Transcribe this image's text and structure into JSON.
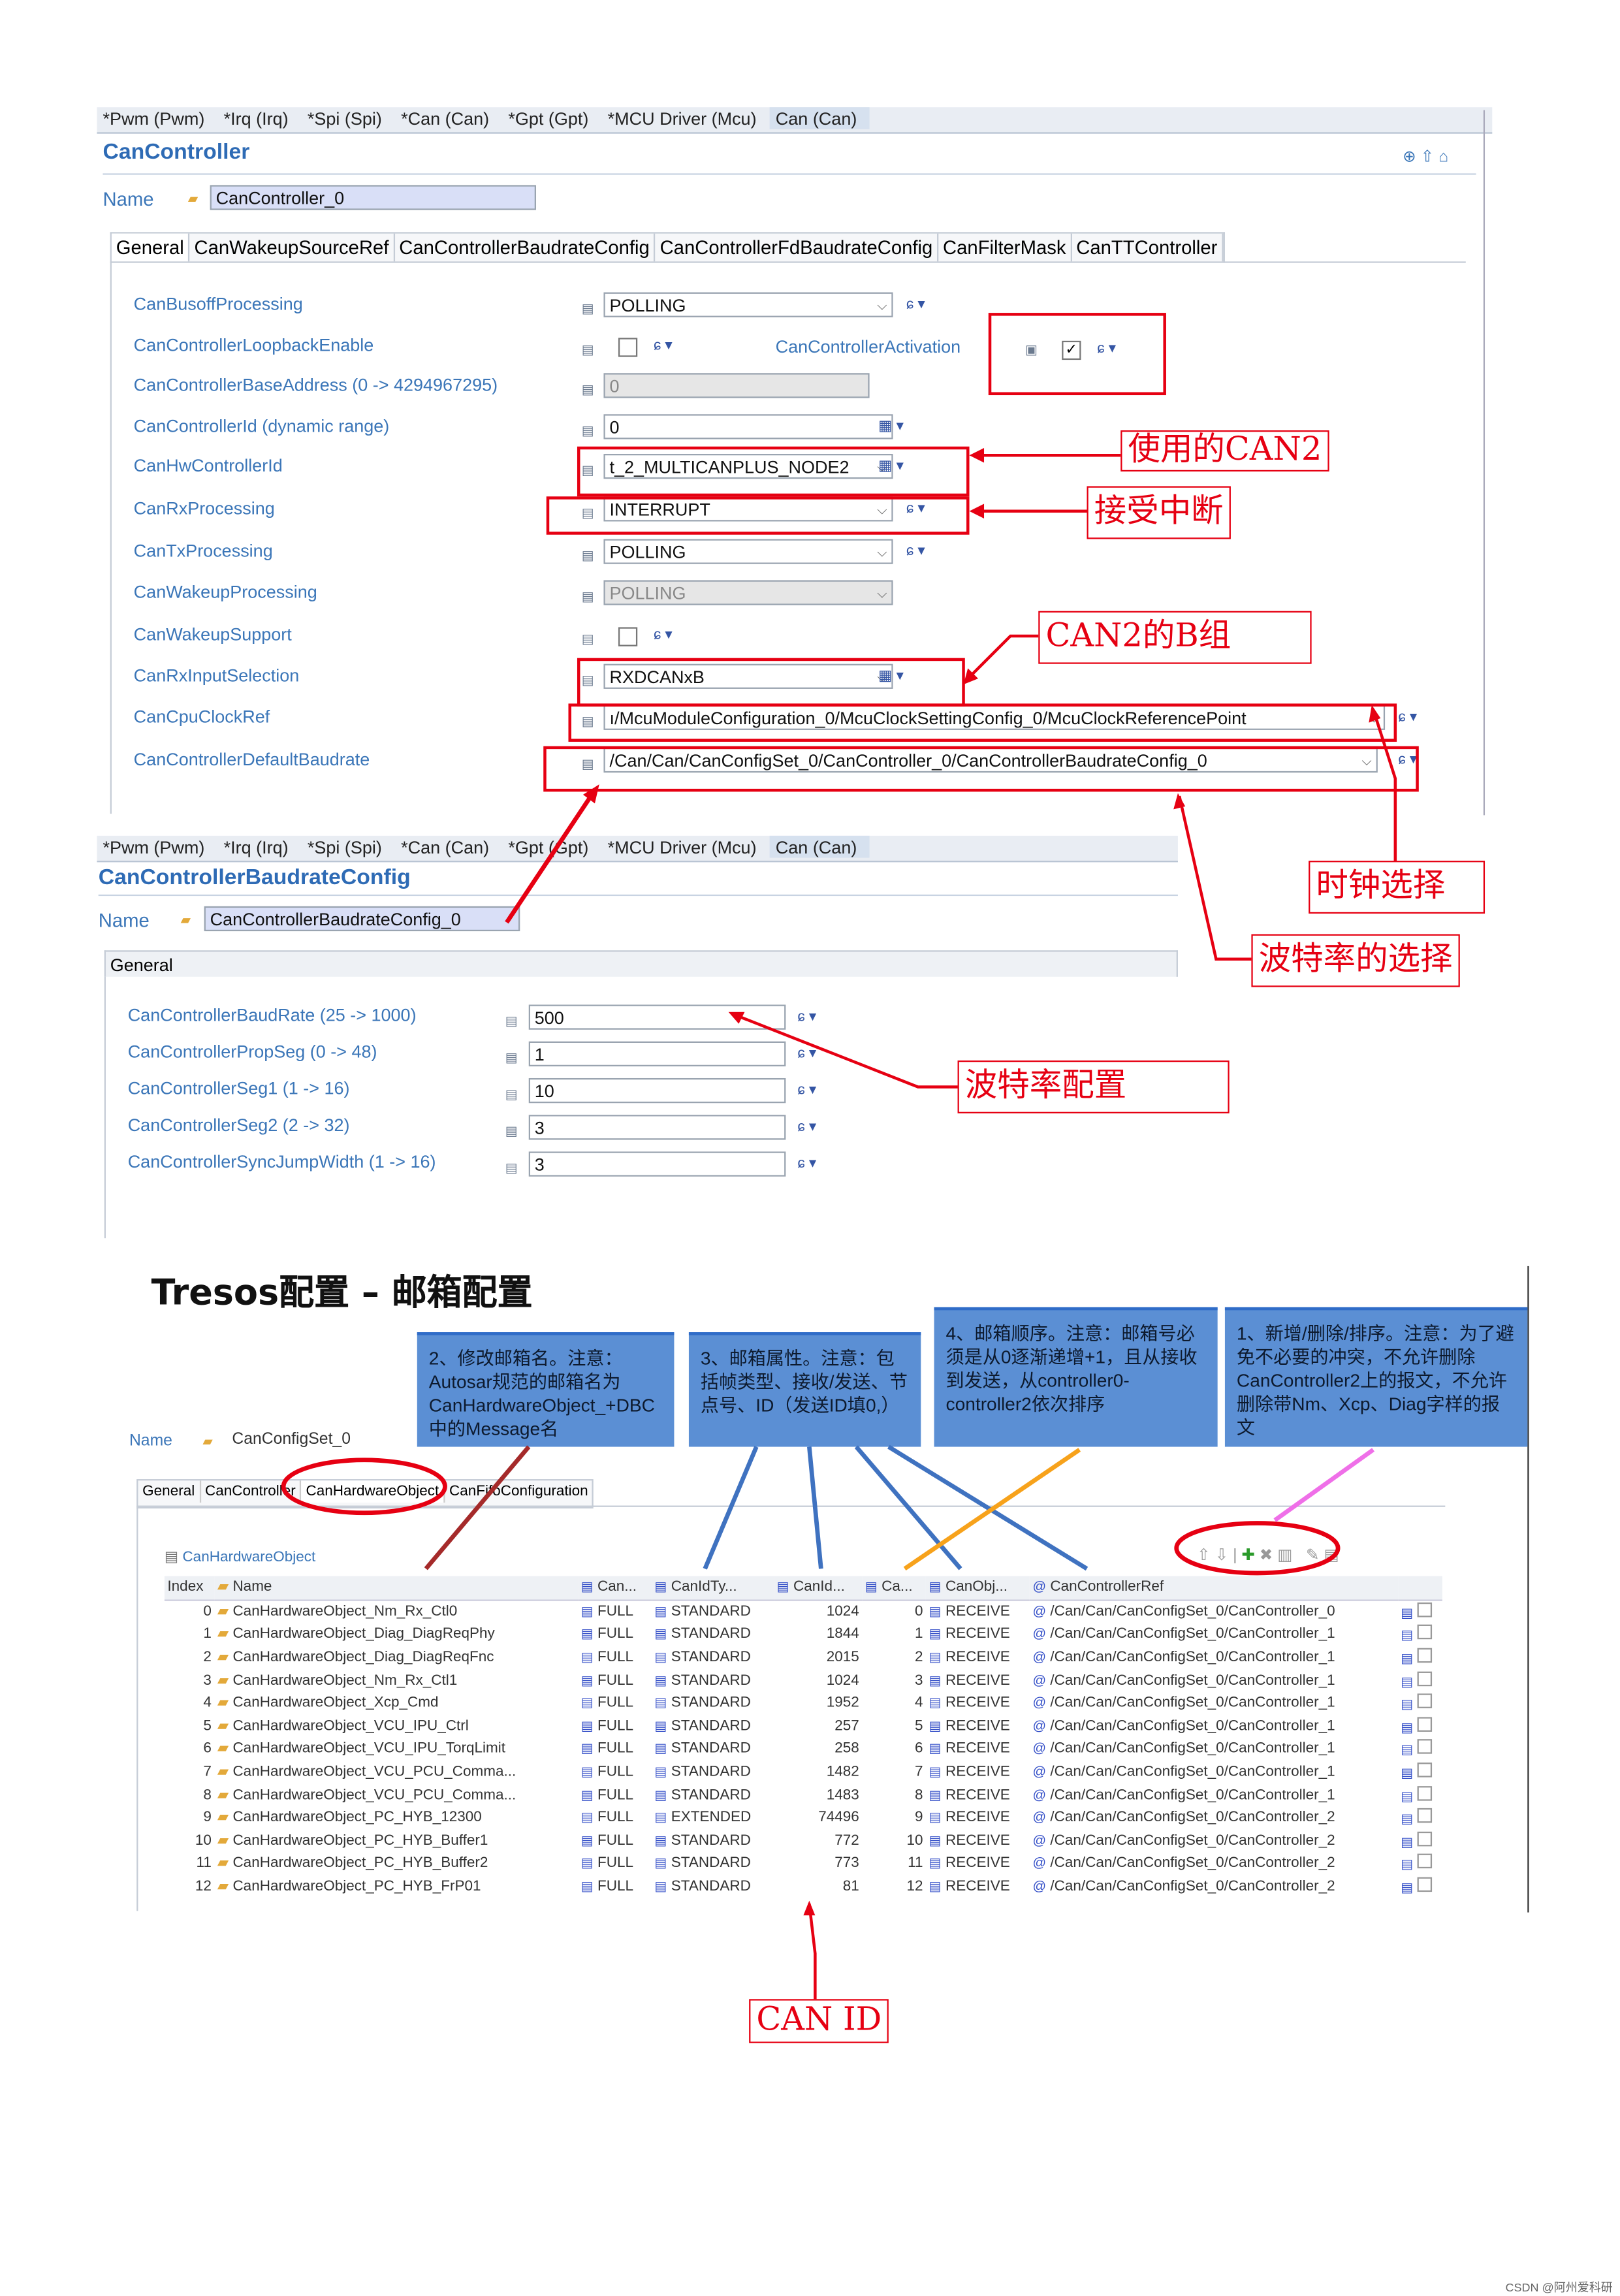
{
  "panel1": {
    "tabs": [
      "*Pwm (Pwm)",
      "*Irq (Irq)",
      "*Spi (Spi)",
      "*Can (Can)",
      "*Gpt (Gpt)",
      "*MCU Driver (Mcu)",
      "Can (Can)"
    ],
    "title": "CanController",
    "name_label": "Name",
    "name_value": "CanController_0",
    "subtabs": [
      "General",
      "CanWakeupSourceRef",
      "CanControllerBaudrateConfig",
      "CanControllerFdBaudrateConfig",
      "CanFilterMask",
      "CanTTController"
    ],
    "fields": [
      {
        "label": "CanBusoffProcessing",
        "value": "POLLING",
        "type": "select"
      },
      {
        "label": "CanControllerLoopbackEnable",
        "value": "",
        "type": "checkbox",
        "checked": false
      },
      {
        "label": "CanControllerBaseAddress (0 -> 4294967295)",
        "value": "0",
        "type": "disabled"
      },
      {
        "label": "CanControllerId (dynamic range)",
        "value": "0",
        "type": "text"
      },
      {
        "label": "CanHwControllerId",
        "value": "t_2_MULTICANPLUS_NODE2",
        "type": "select"
      },
      {
        "label": "CanRxProcessing",
        "value": "INTERRUPT",
        "type": "select"
      },
      {
        "label": "CanTxProcessing",
        "value": "POLLING",
        "type": "select"
      },
      {
        "label": "CanWakeupProcessing",
        "value": "POLLING",
        "type": "disabled-select"
      },
      {
        "label": "CanWakeupSupport",
        "value": "",
        "type": "checkbox",
        "checked": false
      },
      {
        "label": "CanRxInputSelection",
        "value": "RXDCANxB",
        "type": "select"
      },
      {
        "label": "CanCpuClockRef",
        "value": "ı/McuModuleConfiguration_0/McuClockSettingConfig_0/McuClockReferencePoint",
        "type": "ref"
      },
      {
        "label": "CanControllerDefaultBaudrate",
        "value": "/Can/Can/CanConfigSet_0/CanController_0/CanControllerBaudrateConfig_0",
        "type": "ref"
      }
    ],
    "activation_label": "CanControllerActivation",
    "activation_checked": true
  },
  "panel2": {
    "tabs": [
      "*Pwm (Pwm)",
      "*Irq (Irq)",
      "*Spi (Spi)",
      "*Can (Can)",
      "*Gpt (Gpt)",
      "*MCU Driver (Mcu)",
      "Can (Can)"
    ],
    "title": "CanControllerBaudrateConfig",
    "name_label": "Name",
    "name_value": "CanControllerBaudrateConfig_0",
    "subtab": "General",
    "fields": [
      {
        "label": "CanControllerBaudRate (25 -> 1000)",
        "value": "500"
      },
      {
        "label": "CanControllerPropSeg (0 -> 48)",
        "value": "1"
      },
      {
        "label": "CanControllerSeg1 (1 -> 16)",
        "value": "10"
      },
      {
        "label": "CanControllerSeg2 (2 -> 32)",
        "value": "3"
      },
      {
        "label": "CanControllerSyncJumpWidth (1 -> 16)",
        "value": "3"
      }
    ]
  },
  "annotations": {
    "can2": "使用的CAN2",
    "rx_interrupt": "接受中断",
    "can2_b": "CAN2的B组",
    "clock": "时钟选择",
    "baud_select": "波特率的选择",
    "baud_config": "波特率配置",
    "can_id": "CAN  ID"
  },
  "section3": {
    "heading": "Tresos配置 – 邮箱配置",
    "notes": [
      "2、修改邮箱名。注意：Autosar规范的邮箱名为CanHardwareObject_+DBC中的Message名",
      "3、邮箱属性。注意：包括帧类型、接收/发送、节点号、ID（发送ID填0,）",
      "4、邮箱顺序。注意：邮箱号必须是从0逐渐递增+1，且从接收到发送，从controller0-controller2依次排序",
      "1、新增/删除/排序。注意：为了避免不必要的冲突，不允许删除CanController2上的报文，不允许删除带Nm、Xcp、Diag字样的报文"
    ],
    "name_label": "Name",
    "name_value": "CanConfigSet_0",
    "tabs": [
      "General",
      "CanController",
      "CanHardwareObject",
      "CanFifoConfiguration"
    ],
    "table_title": "CanHardwareObject",
    "columns": [
      "Index",
      "Name",
      "Can...",
      "CanIdTy...",
      "CanId...",
      "Ca...",
      "CanObj...",
      "CanControllerRef"
    ],
    "rows": [
      [
        0,
        "CanHardwareObject_Nm_Rx_Ctl0",
        "FULL",
        "STANDARD",
        1024,
        0,
        "RECEIVE",
        "/Can/Can/CanConfigSet_0/CanController_0"
      ],
      [
        1,
        "CanHardwareObject_Diag_DiagReqPhy",
        "FULL",
        "STANDARD",
        1844,
        1,
        "RECEIVE",
        "/Can/Can/CanConfigSet_0/CanController_1"
      ],
      [
        2,
        "CanHardwareObject_Diag_DiagReqFnc",
        "FULL",
        "STANDARD",
        2015,
        2,
        "RECEIVE",
        "/Can/Can/CanConfigSet_0/CanController_1"
      ],
      [
        3,
        "CanHardwareObject_Nm_Rx_Ctl1",
        "FULL",
        "STANDARD",
        1024,
        3,
        "RECEIVE",
        "/Can/Can/CanConfigSet_0/CanController_1"
      ],
      [
        4,
        "CanHardwareObject_Xcp_Cmd",
        "FULL",
        "STANDARD",
        1952,
        4,
        "RECEIVE",
        "/Can/Can/CanConfigSet_0/CanController_1"
      ],
      [
        5,
        "CanHardwareObject_VCU_IPU_Ctrl",
        "FULL",
        "STANDARD",
        257,
        5,
        "RECEIVE",
        "/Can/Can/CanConfigSet_0/CanController_1"
      ],
      [
        6,
        "CanHardwareObject_VCU_IPU_TorqLimit",
        "FULL",
        "STANDARD",
        258,
        6,
        "RECEIVE",
        "/Can/Can/CanConfigSet_0/CanController_1"
      ],
      [
        7,
        "CanHardwareObject_VCU_PCU_Comma...",
        "FULL",
        "STANDARD",
        1482,
        7,
        "RECEIVE",
        "/Can/Can/CanConfigSet_0/CanController_1"
      ],
      [
        8,
        "CanHardwareObject_VCU_PCU_Comma...",
        "FULL",
        "STANDARD",
        1483,
        8,
        "RECEIVE",
        "/Can/Can/CanConfigSet_0/CanController_1"
      ],
      [
        9,
        "CanHardwareObject_PC_HYB_12300",
        "FULL",
        "EXTENDED",
        74496,
        9,
        "RECEIVE",
        "/Can/Can/CanConfigSet_0/CanController_2"
      ],
      [
        10,
        "CanHardwareObject_PC_HYB_Buffer1",
        "FULL",
        "STANDARD",
        772,
        10,
        "RECEIVE",
        "/Can/Can/CanConfigSet_0/CanController_2"
      ],
      [
        11,
        "CanHardwareObject_PC_HYB_Buffer2",
        "FULL",
        "STANDARD",
        773,
        11,
        "RECEIVE",
        "/Can/Can/CanConfigSet_0/CanController_2"
      ],
      [
        12,
        "CanHardwareObject_PC_HYB_FrP01",
        "FULL",
        "STANDARD",
        81,
        12,
        "RECEIVE",
        "/Can/Can/CanConfigSet_0/CanController_2"
      ]
    ]
  },
  "watermark": "CSDN @阿州爱科研",
  "colors": {
    "annotation": "#e60012",
    "note_box": "#5b8fd4",
    "label": "#3b76b8"
  }
}
